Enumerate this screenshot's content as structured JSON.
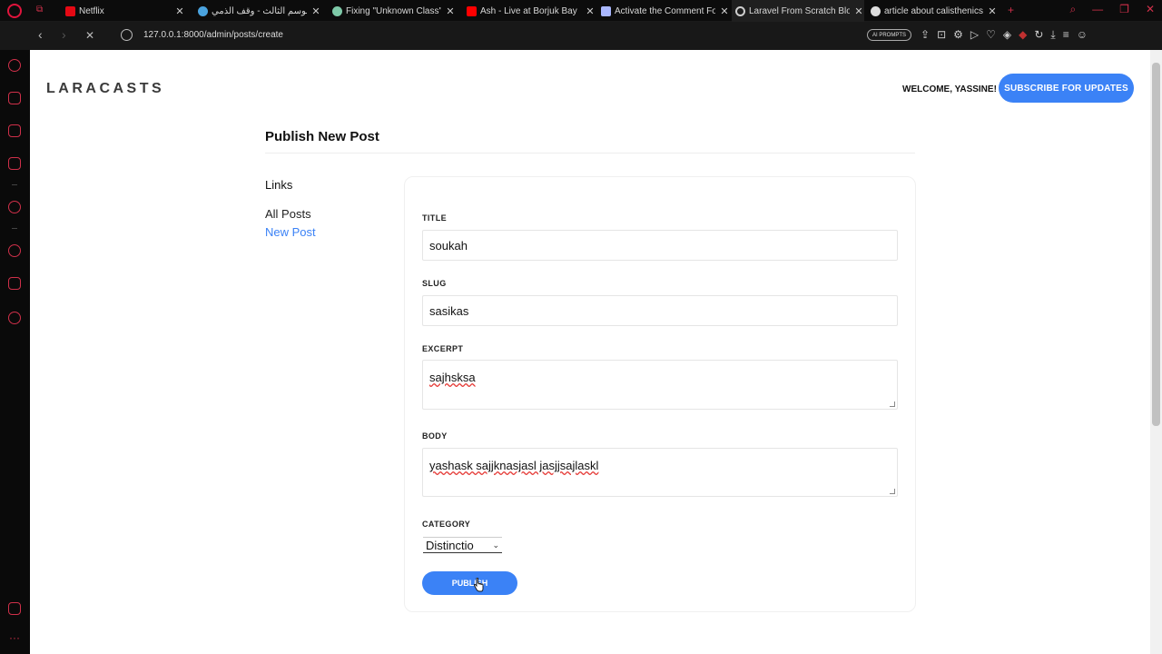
{
  "browser": {
    "tabs": [
      {
        "label": "Netflix",
        "favicon_color": "#e50914"
      },
      {
        "label": "لموسم الثالث - وقف الذمي",
        "favicon_color": "#4aa3df"
      },
      {
        "label": "Fixing \"Unknown Class\"",
        "favicon_color": "#7ec9a8"
      },
      {
        "label": "Ash - Live at Borjuk Bay",
        "favicon_color": "#ff0000"
      },
      {
        "label": "Activate the Comment Fo",
        "favicon_color": "#aab8ff"
      },
      {
        "label": "Laravel From Scratch Blo",
        "favicon_color": "#cfcfcf"
      },
      {
        "label": "article about calisthenics",
        "favicon_color": "#dddddd"
      }
    ],
    "active_tab_index": 5,
    "url": "127.0.0.1:8000/admin/posts/create",
    "prompts_label": "AI PROMPTS",
    "accent": "#d0304a"
  },
  "header": {
    "logo": "LARACASTS",
    "welcome": "WELCOME, YASSINE!",
    "subscribe_label": "SUBSCRIBE FOR UPDATES"
  },
  "page": {
    "title": "Publish New Post",
    "links_heading": "Links",
    "links": [
      "All Posts",
      "New Post"
    ]
  },
  "form": {
    "title_label": "TITLE",
    "title_value": "soukah",
    "slug_label": "SLUG",
    "slug_value": "sasikas",
    "excerpt_label": "EXCERPT",
    "excerpt_value": "sajhsksa",
    "body_label": "BODY",
    "body_value": "yashask sajjknasjasl jasjjsajlaskl",
    "category_label": "CATEGORY",
    "category_value": "Distinctio",
    "publish_label": "PUBLISH"
  },
  "colors": {
    "primary": "#3b82f6"
  }
}
